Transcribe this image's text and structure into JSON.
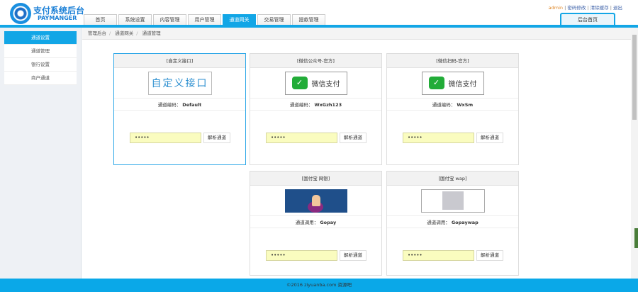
{
  "brand": {
    "title": "支付系统后台",
    "subtitle": "PAYMANGER"
  },
  "tabs": [
    "首页",
    "系统设置",
    "内容管理",
    "用户管理",
    "通道网关",
    "交易管理",
    "提款管理"
  ],
  "active_tab": 4,
  "toplinks": {
    "user": "admin",
    "change_password": "密码修改",
    "clear_cache": "清除缓存",
    "logout": "退出"
  },
  "home_button": "后台首页",
  "sidebar": [
    "通道设置",
    "通道管理",
    "银行设置",
    "商户通道"
  ],
  "breadcrumb": [
    "管理后台",
    "通道网关",
    "通道管理"
  ],
  "cards": [
    {
      "title": "[自定义接口]",
      "logo_text": "自定义接口",
      "label": "通道编码：",
      "code": "Default",
      "password": "•••••",
      "button": "解析通道"
    },
    {
      "title": "[微信公众号-官方]",
      "logo_text": "微信支付",
      "label": "通道编码：",
      "code": "WxGzh123",
      "password": "•••••",
      "button": "解析通道"
    },
    {
      "title": "[微信扫码-官方]",
      "logo_text": "微信支付",
      "label": "通道编码：",
      "code": "WxSm",
      "password": "•••••",
      "button": "解析通道"
    },
    {
      "title": "[国付宝 网银]",
      "label": "通道调用：",
      "code": "Gopay",
      "password": "•••••",
      "button": "解析通道"
    },
    {
      "title": "[国付宝 wap]",
      "label": "通道调用：",
      "code": "Gopaywap",
      "password": "•••••",
      "button": "解析通道"
    }
  ],
  "footer": "©2016 ziyuanba.com 资源吧",
  "colors": {
    "accent": "#12a6e6",
    "wechat": "#22ac38"
  }
}
